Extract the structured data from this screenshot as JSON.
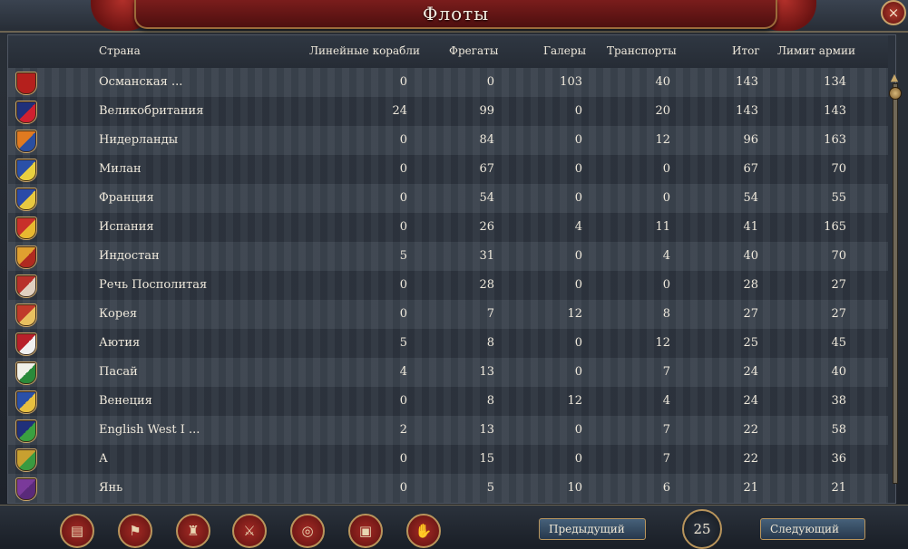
{
  "window": {
    "title": "Флоты",
    "close_icon": "×"
  },
  "columns": {
    "country": "Страна",
    "heavy": "Линейные корабли",
    "light": "Фрегаты",
    "galleys": "Галеры",
    "transports": "Транспорты",
    "total": "Итог",
    "limit": "Лимит армии"
  },
  "rows": [
    {
      "country": "Османская  ...",
      "heavy": "0",
      "light": "0",
      "galleys": "103",
      "transports": "40",
      "total": "143",
      "limit": "134",
      "flag_colors": [
        "#b5201d",
        "#b5201d"
      ]
    },
    {
      "country": "Великобритания",
      "heavy": "24",
      "light": "99",
      "galleys": "0",
      "transports": "20",
      "total": "143",
      "limit": "143",
      "flag_colors": [
        "#20307a",
        "#d12030"
      ]
    },
    {
      "country": "Нидерланды",
      "heavy": "0",
      "light": "84",
      "galleys": "0",
      "transports": "12",
      "total": "96",
      "limit": "163",
      "flag_colors": [
        "#e07a20",
        "#2a4fa0"
      ]
    },
    {
      "country": "Милан",
      "heavy": "0",
      "light": "67",
      "galleys": "0",
      "transports": "0",
      "total": "67",
      "limit": "70",
      "flag_colors": [
        "#2a50a8",
        "#e8d040"
      ]
    },
    {
      "country": "Франция",
      "heavy": "0",
      "light": "54",
      "galleys": "0",
      "transports": "0",
      "total": "54",
      "limit": "55",
      "flag_colors": [
        "#2a4aa8",
        "#e8c840"
      ]
    },
    {
      "country": "Испания",
      "heavy": "0",
      "light": "26",
      "galleys": "4",
      "transports": "11",
      "total": "41",
      "limit": "165",
      "flag_colors": [
        "#c8302a",
        "#e8b830"
      ]
    },
    {
      "country": "Индостан",
      "heavy": "5",
      "light": "31",
      "galleys": "0",
      "transports": "4",
      "total": "40",
      "limit": "70",
      "flag_colors": [
        "#e0a030",
        "#b02a20"
      ]
    },
    {
      "country": "Речь Посполитая",
      "heavy": "0",
      "light": "28",
      "galleys": "0",
      "transports": "0",
      "total": "28",
      "limit": "27",
      "flag_colors": [
        "#b8302a",
        "#e0d0c0"
      ]
    },
    {
      "country": "Корея",
      "heavy": "0",
      "light": "7",
      "galleys": "12",
      "transports": "8",
      "total": "27",
      "limit": "27",
      "flag_colors": [
        "#c03a2a",
        "#e8c060"
      ]
    },
    {
      "country": "Аютия",
      "heavy": "5",
      "light": "8",
      "galleys": "0",
      "transports": "12",
      "total": "25",
      "limit": "45",
      "flag_colors": [
        "#b8202a",
        "#f0f0f0"
      ]
    },
    {
      "country": "Пасай",
      "heavy": "4",
      "light": "13",
      "galleys": "0",
      "transports": "7",
      "total": "24",
      "limit": "40",
      "flag_colors": [
        "#f0f0e8",
        "#2a8a3a"
      ]
    },
    {
      "country": "Венеция",
      "heavy": "0",
      "light": "8",
      "galleys": "12",
      "transports": "4",
      "total": "24",
      "limit": "38",
      "flag_colors": [
        "#2a50a8",
        "#e8c040"
      ]
    },
    {
      "country": "English West I ...",
      "heavy": "2",
      "light": "13",
      "galleys": "0",
      "transports": "7",
      "total": "22",
      "limit": "58",
      "flag_colors": [
        "#20307a",
        "#3aa040"
      ]
    },
    {
      "country": "А",
      "heavy": "0",
      "light": "15",
      "galleys": "0",
      "transports": "7",
      "total": "22",
      "limit": "36",
      "flag_colors": [
        "#c8a030",
        "#3a9a40"
      ]
    },
    {
      "country": "Янь",
      "heavy": "0",
      "light": "5",
      "galleys": "10",
      "transports": "6",
      "total": "21",
      "limit": "21",
      "flag_colors": [
        "#7a3a9a",
        "#5a2a7a"
      ]
    }
  ],
  "footer": {
    "prev_label": "Предыдущий",
    "next_label": "Следующий",
    "page": "25",
    "tools": [
      "ledger-icon",
      "flag-icon",
      "army-icon",
      "crossed-swords-icon",
      "coins-icon",
      "crate-icon",
      "handshake-icon"
    ],
    "tool_glyphs": [
      "▤",
      "⚑",
      "♜",
      "⚔",
      "◎",
      "▣",
      "✋"
    ]
  }
}
